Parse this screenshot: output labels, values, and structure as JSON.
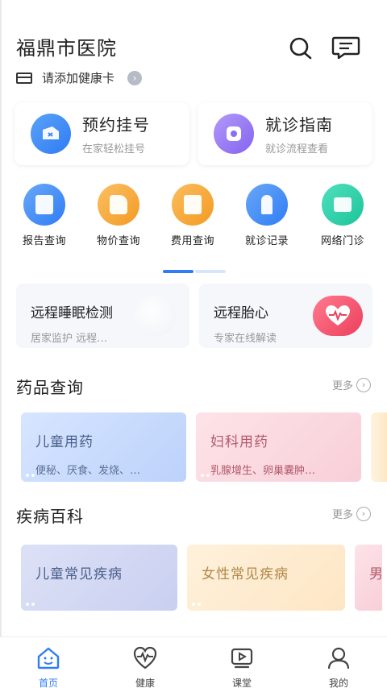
{
  "header": {
    "title": "福鼎市医院",
    "health_card_text": "请添加健康卡"
  },
  "main_cards": [
    {
      "title": "预约挂号",
      "subtitle": "在家轻松挂号",
      "icon": "ticket-icon",
      "color": "#3f8cf0"
    },
    {
      "title": "就诊指南",
      "subtitle": "就诊流程查看",
      "icon": "compass-icon",
      "color": "#9a7ef5"
    }
  ],
  "quick_actions": [
    {
      "label": "报告查询",
      "icon": "report-icon",
      "color": "#3d8cf2"
    },
    {
      "label": "物价查询",
      "icon": "price-tag-icon",
      "color": "#f8a838"
    },
    {
      "label": "费用查询",
      "icon": "fee-icon",
      "color": "#f7a336"
    },
    {
      "label": "就诊记录",
      "icon": "visit-record-icon",
      "color": "#3d8cf2"
    },
    {
      "label": "网络门诊",
      "icon": "online-clinic-icon",
      "color": "#2ecfa8"
    }
  ],
  "remote_services": [
    {
      "title": "远程睡眠检测",
      "subtitle": "居家监护 远程…"
    },
    {
      "title": "远程胎心",
      "subtitle": "专家在线解读"
    }
  ],
  "drug_section": {
    "title": "药品查询",
    "more_label": "更多",
    "items": [
      {
        "title": "儿童用药",
        "subtitle": "便秘、厌食、发烧、…",
        "title_color": "#4a5f8a",
        "sub_color": "#6a7da3"
      },
      {
        "title": "妇科用药",
        "subtitle": "乳腺增生、卵巢囊肿…",
        "title_color": "#b25a6a",
        "sub_color": "#b25a6a"
      }
    ]
  },
  "disease_section": {
    "title": "疾病百科",
    "more_label": "更多",
    "items": [
      {
        "title": "儿童常见疾病",
        "title_color": "#4a5f8a"
      },
      {
        "title": "女性常见疾病",
        "title_color": "#b0884a"
      },
      {
        "title": "男",
        "title_color": "#b25a6a"
      }
    ]
  },
  "tabbar": {
    "items": [
      {
        "label": "首页",
        "icon": "home-smile-icon",
        "active": true
      },
      {
        "label": "健康",
        "icon": "heart-pulse-icon",
        "active": false
      },
      {
        "label": "课堂",
        "icon": "video-play-icon",
        "active": false
      },
      {
        "label": "我的",
        "icon": "user-icon",
        "active": false
      }
    ]
  },
  "colors": {
    "accent": "#2f7cf6",
    "heart": "#f0506a"
  }
}
